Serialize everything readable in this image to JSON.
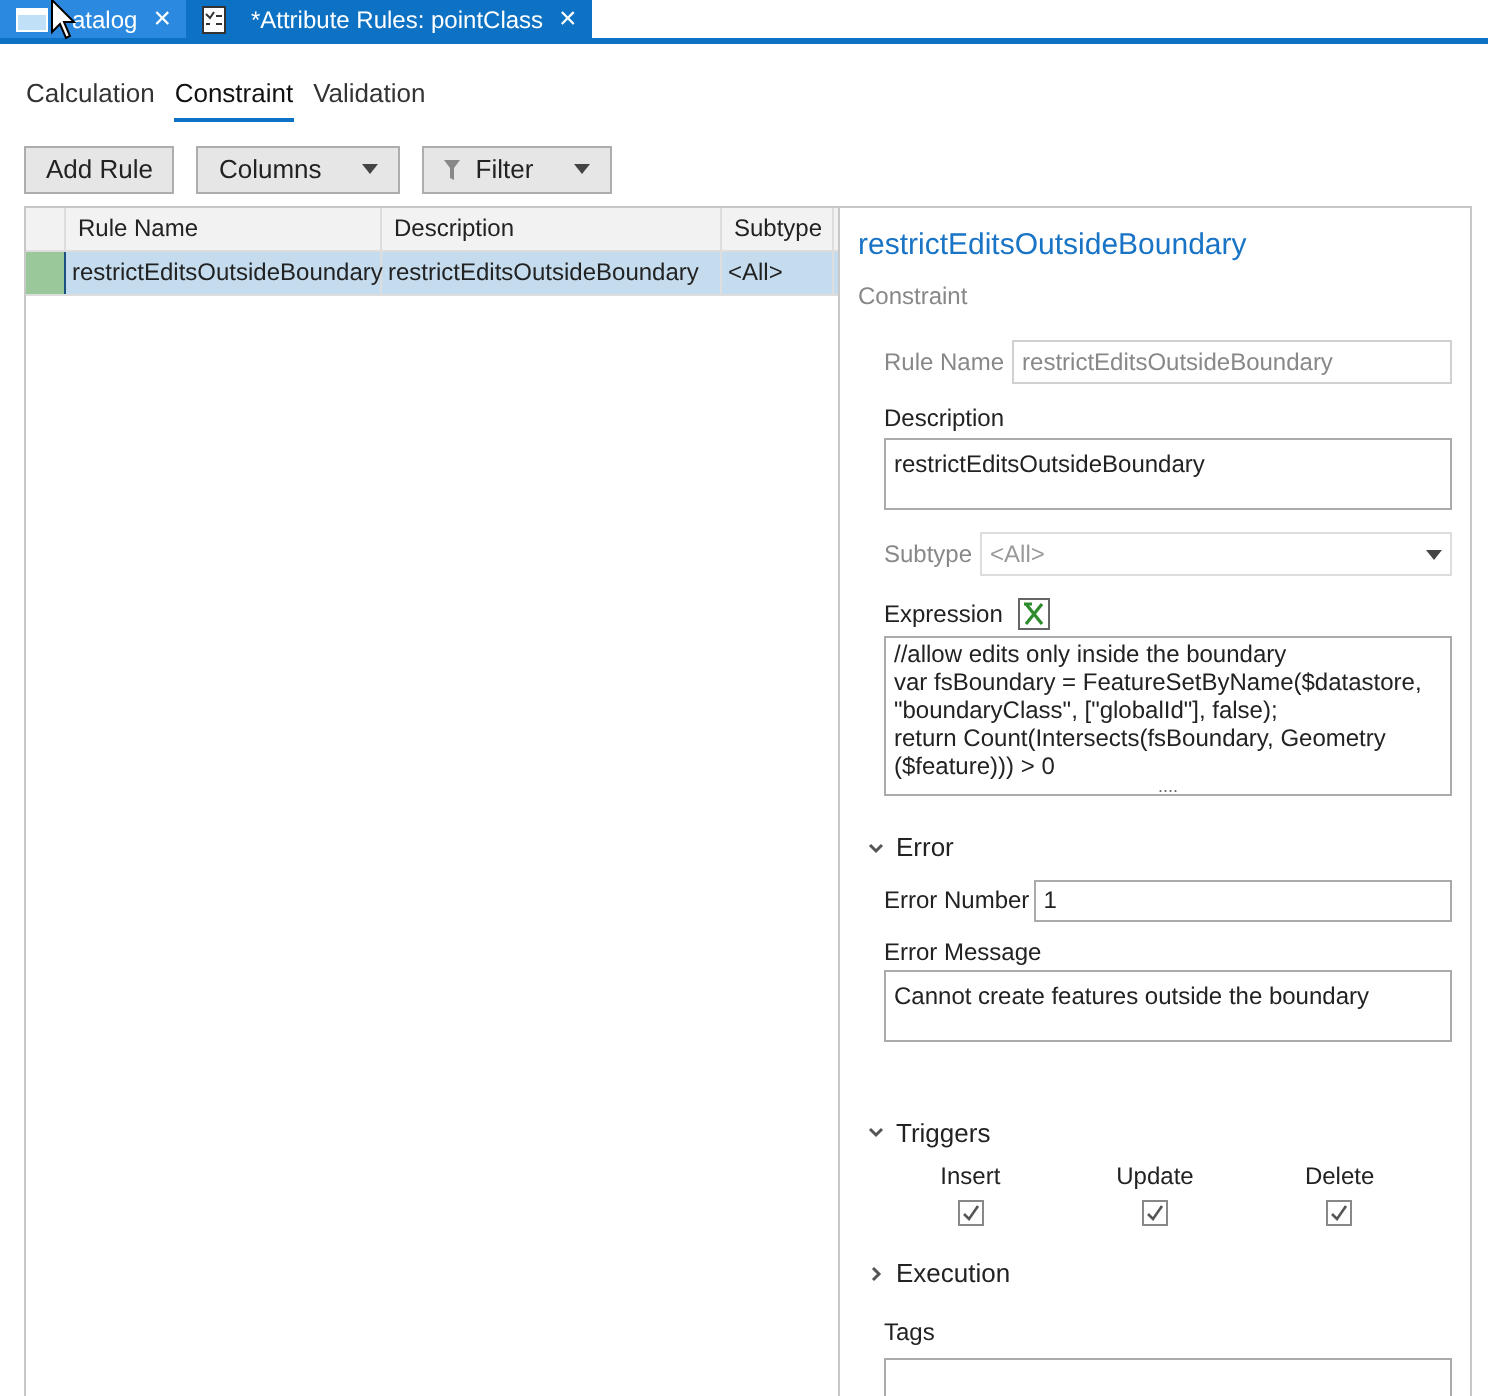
{
  "doc_tabs": [
    {
      "label": "atalog",
      "close": "×",
      "selected": false,
      "kind": "catalog"
    },
    {
      "label": "*Attribute Rules: pointClass",
      "close": "×",
      "selected": true,
      "kind": "rules"
    }
  ],
  "rule_tabs": [
    {
      "label": "Calculation",
      "selected": false
    },
    {
      "label": "Constraint",
      "selected": true
    },
    {
      "label": "Validation",
      "selected": false
    }
  ],
  "toolbar": [
    {
      "label": "Add Rule",
      "kind": "plain"
    },
    {
      "label": "Columns",
      "kind": "dropdown"
    },
    {
      "label": "Filter",
      "kind": "filter"
    }
  ],
  "table": {
    "columns": [
      "Rule Name",
      "Description",
      "Subtype"
    ],
    "rows": [
      {
        "cells": [
          "restrictEditsOutsideBoundary",
          "restrictEditsOutsideBoundary",
          "<All>"
        ],
        "selected": true
      }
    ]
  },
  "details": {
    "title": "restrictEditsOutsideBoundary",
    "subtitle": "Constraint",
    "rule_name": {
      "label": "Rule Name",
      "value": "restrictEditsOutsideBoundary",
      "disabled": true
    },
    "description": {
      "label": "Description",
      "value": "restrictEditsOutsideBoundary"
    },
    "subtype": {
      "label": "Subtype",
      "value": "<All>",
      "disabled": true
    },
    "expression": {
      "label": "Expression",
      "lines": [
        "//allow edits only inside the boundary",
        "var fsBoundary = FeatureSetByName($datastore, \"boundaryClass\", [\"globalId\"], false);",
        "return Count(Intersects(fsBoundary, Geometry ($feature))) > 0"
      ],
      "more": "...."
    },
    "error": {
      "label": "Error",
      "expanded": true,
      "number_label": "Error Number",
      "number": "1",
      "message_label": "Error Message",
      "message": "Cannot create features outside the boundary"
    },
    "triggers": {
      "label": "Triggers",
      "expanded": true,
      "items": [
        {
          "label": "Insert",
          "checked": true
        },
        {
          "label": "Update",
          "checked": true
        },
        {
          "label": "Delete",
          "checked": true
        }
      ]
    },
    "execution": {
      "label": "Execution",
      "expanded": false
    },
    "tags": {
      "label": "Tags"
    }
  }
}
